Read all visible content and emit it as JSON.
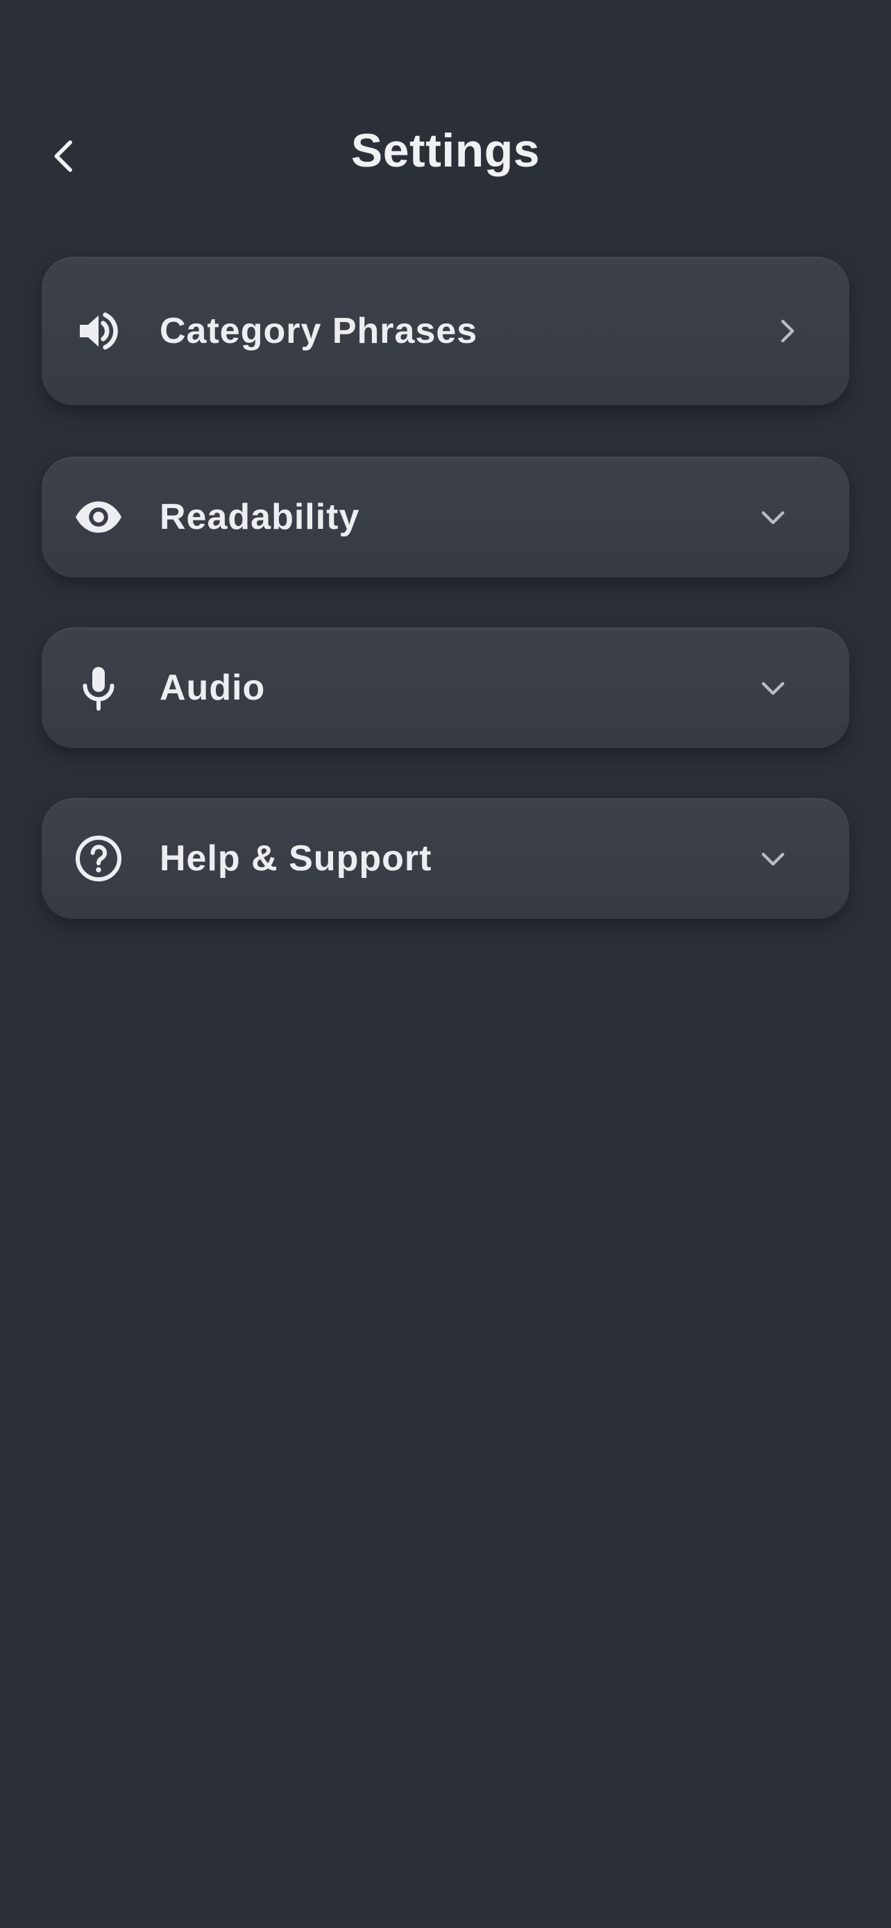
{
  "header": {
    "title": "Settings",
    "back_icon": "chevron-left-icon"
  },
  "settings": {
    "items": [
      {
        "label": "Category Phrases",
        "icon": "speaker-icon",
        "trailing": "chevron-right-icon",
        "state": "navigate"
      },
      {
        "label": "Readability",
        "icon": "eye-icon",
        "trailing": "chevron-down-icon",
        "state": "collapsed"
      },
      {
        "label": "Audio",
        "icon": "microphone-icon",
        "trailing": "chevron-down-icon",
        "state": "collapsed"
      },
      {
        "label": "Help & Support",
        "icon": "help-circle-icon",
        "trailing": "chevron-down-icon",
        "state": "collapsed"
      }
    ]
  },
  "colors": {
    "background": "#2b3038",
    "card": "#393d46",
    "text": "#eceef1",
    "chevron": "#b8bbc2"
  }
}
